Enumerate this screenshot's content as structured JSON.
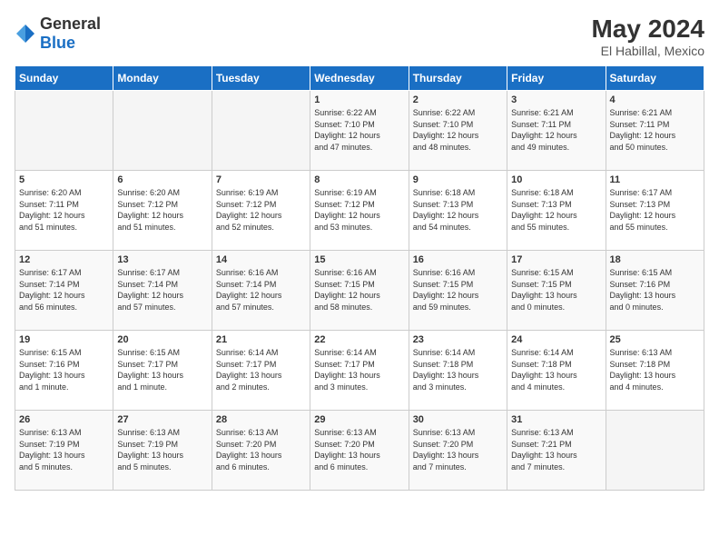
{
  "logo": {
    "general": "General",
    "blue": "Blue"
  },
  "title": {
    "month_year": "May 2024",
    "location": "El Habillal, Mexico"
  },
  "days_of_week": [
    "Sunday",
    "Monday",
    "Tuesday",
    "Wednesday",
    "Thursday",
    "Friday",
    "Saturday"
  ],
  "weeks": [
    [
      {
        "day": "",
        "info": ""
      },
      {
        "day": "",
        "info": ""
      },
      {
        "day": "",
        "info": ""
      },
      {
        "day": "1",
        "info": "Sunrise: 6:22 AM\nSunset: 7:10 PM\nDaylight: 12 hours\nand 47 minutes."
      },
      {
        "day": "2",
        "info": "Sunrise: 6:22 AM\nSunset: 7:10 PM\nDaylight: 12 hours\nand 48 minutes."
      },
      {
        "day": "3",
        "info": "Sunrise: 6:21 AM\nSunset: 7:11 PM\nDaylight: 12 hours\nand 49 minutes."
      },
      {
        "day": "4",
        "info": "Sunrise: 6:21 AM\nSunset: 7:11 PM\nDaylight: 12 hours\nand 50 minutes."
      }
    ],
    [
      {
        "day": "5",
        "info": "Sunrise: 6:20 AM\nSunset: 7:11 PM\nDaylight: 12 hours\nand 51 minutes."
      },
      {
        "day": "6",
        "info": "Sunrise: 6:20 AM\nSunset: 7:12 PM\nDaylight: 12 hours\nand 51 minutes."
      },
      {
        "day": "7",
        "info": "Sunrise: 6:19 AM\nSunset: 7:12 PM\nDaylight: 12 hours\nand 52 minutes."
      },
      {
        "day": "8",
        "info": "Sunrise: 6:19 AM\nSunset: 7:12 PM\nDaylight: 12 hours\nand 53 minutes."
      },
      {
        "day": "9",
        "info": "Sunrise: 6:18 AM\nSunset: 7:13 PM\nDaylight: 12 hours\nand 54 minutes."
      },
      {
        "day": "10",
        "info": "Sunrise: 6:18 AM\nSunset: 7:13 PM\nDaylight: 12 hours\nand 55 minutes."
      },
      {
        "day": "11",
        "info": "Sunrise: 6:17 AM\nSunset: 7:13 PM\nDaylight: 12 hours\nand 55 minutes."
      }
    ],
    [
      {
        "day": "12",
        "info": "Sunrise: 6:17 AM\nSunset: 7:14 PM\nDaylight: 12 hours\nand 56 minutes."
      },
      {
        "day": "13",
        "info": "Sunrise: 6:17 AM\nSunset: 7:14 PM\nDaylight: 12 hours\nand 57 minutes."
      },
      {
        "day": "14",
        "info": "Sunrise: 6:16 AM\nSunset: 7:14 PM\nDaylight: 12 hours\nand 57 minutes."
      },
      {
        "day": "15",
        "info": "Sunrise: 6:16 AM\nSunset: 7:15 PM\nDaylight: 12 hours\nand 58 minutes."
      },
      {
        "day": "16",
        "info": "Sunrise: 6:16 AM\nSunset: 7:15 PM\nDaylight: 12 hours\nand 59 minutes."
      },
      {
        "day": "17",
        "info": "Sunrise: 6:15 AM\nSunset: 7:15 PM\nDaylight: 13 hours\nand 0 minutes."
      },
      {
        "day": "18",
        "info": "Sunrise: 6:15 AM\nSunset: 7:16 PM\nDaylight: 13 hours\nand 0 minutes."
      }
    ],
    [
      {
        "day": "19",
        "info": "Sunrise: 6:15 AM\nSunset: 7:16 PM\nDaylight: 13 hours\nand 1 minute."
      },
      {
        "day": "20",
        "info": "Sunrise: 6:15 AM\nSunset: 7:17 PM\nDaylight: 13 hours\nand 1 minute."
      },
      {
        "day": "21",
        "info": "Sunrise: 6:14 AM\nSunset: 7:17 PM\nDaylight: 13 hours\nand 2 minutes."
      },
      {
        "day": "22",
        "info": "Sunrise: 6:14 AM\nSunset: 7:17 PM\nDaylight: 13 hours\nand 3 minutes."
      },
      {
        "day": "23",
        "info": "Sunrise: 6:14 AM\nSunset: 7:18 PM\nDaylight: 13 hours\nand 3 minutes."
      },
      {
        "day": "24",
        "info": "Sunrise: 6:14 AM\nSunset: 7:18 PM\nDaylight: 13 hours\nand 4 minutes."
      },
      {
        "day": "25",
        "info": "Sunrise: 6:13 AM\nSunset: 7:18 PM\nDaylight: 13 hours\nand 4 minutes."
      }
    ],
    [
      {
        "day": "26",
        "info": "Sunrise: 6:13 AM\nSunset: 7:19 PM\nDaylight: 13 hours\nand 5 minutes."
      },
      {
        "day": "27",
        "info": "Sunrise: 6:13 AM\nSunset: 7:19 PM\nDaylight: 13 hours\nand 5 minutes."
      },
      {
        "day": "28",
        "info": "Sunrise: 6:13 AM\nSunset: 7:20 PM\nDaylight: 13 hours\nand 6 minutes."
      },
      {
        "day": "29",
        "info": "Sunrise: 6:13 AM\nSunset: 7:20 PM\nDaylight: 13 hours\nand 6 minutes."
      },
      {
        "day": "30",
        "info": "Sunrise: 6:13 AM\nSunset: 7:20 PM\nDaylight: 13 hours\nand 7 minutes."
      },
      {
        "day": "31",
        "info": "Sunrise: 6:13 AM\nSunset: 7:21 PM\nDaylight: 13 hours\nand 7 minutes."
      },
      {
        "day": "",
        "info": ""
      }
    ]
  ]
}
